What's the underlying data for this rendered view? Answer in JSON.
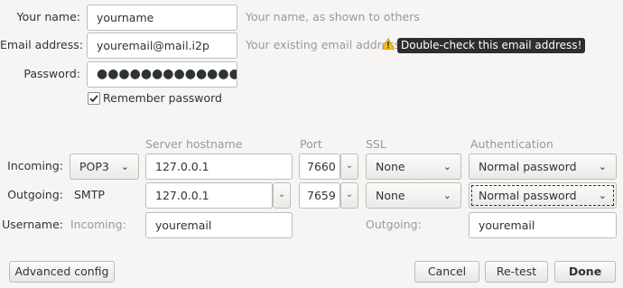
{
  "identity": {
    "name_label": "Your name:",
    "name_value": "yourname",
    "name_hint": "Your name, as shown to others",
    "email_label": "Email address:",
    "email_value": "youremail@mail.i2p",
    "email_hint": "Your existing email address",
    "email_warning": "Double-check this email address!",
    "password_label": "Password:",
    "password_value": "●●●●●●●●●●●●●●●",
    "remember_label": "Remember password",
    "remember_checked": true
  },
  "columns": {
    "hostname": "Server hostname",
    "port": "Port",
    "ssl": "SSL",
    "auth": "Authentication"
  },
  "incoming": {
    "label": "Incoming:",
    "protocol": "POP3",
    "hostname": "127.0.0.1",
    "port": "7660",
    "ssl": "None",
    "auth": "Normal password"
  },
  "outgoing": {
    "label": "Outgoing:",
    "protocol": "SMTP",
    "hostname": "127.0.0.1",
    "port": "7659",
    "ssl": "None",
    "auth": "Normal password"
  },
  "username": {
    "label": "Username:",
    "incoming_label": "Incoming:",
    "incoming_value": "youremail",
    "outgoing_label": "Outgoing:",
    "outgoing_value": "youremail"
  },
  "buttons": {
    "advanced": "Advanced config",
    "cancel": "Cancel",
    "retest": "Re-test",
    "done": "Done"
  },
  "icons": {
    "warning": "warning-icon",
    "checkbox": "checkbox-checked-icon",
    "dropdown": "chevron-down-icon",
    "spin": "spin-down-icon"
  }
}
